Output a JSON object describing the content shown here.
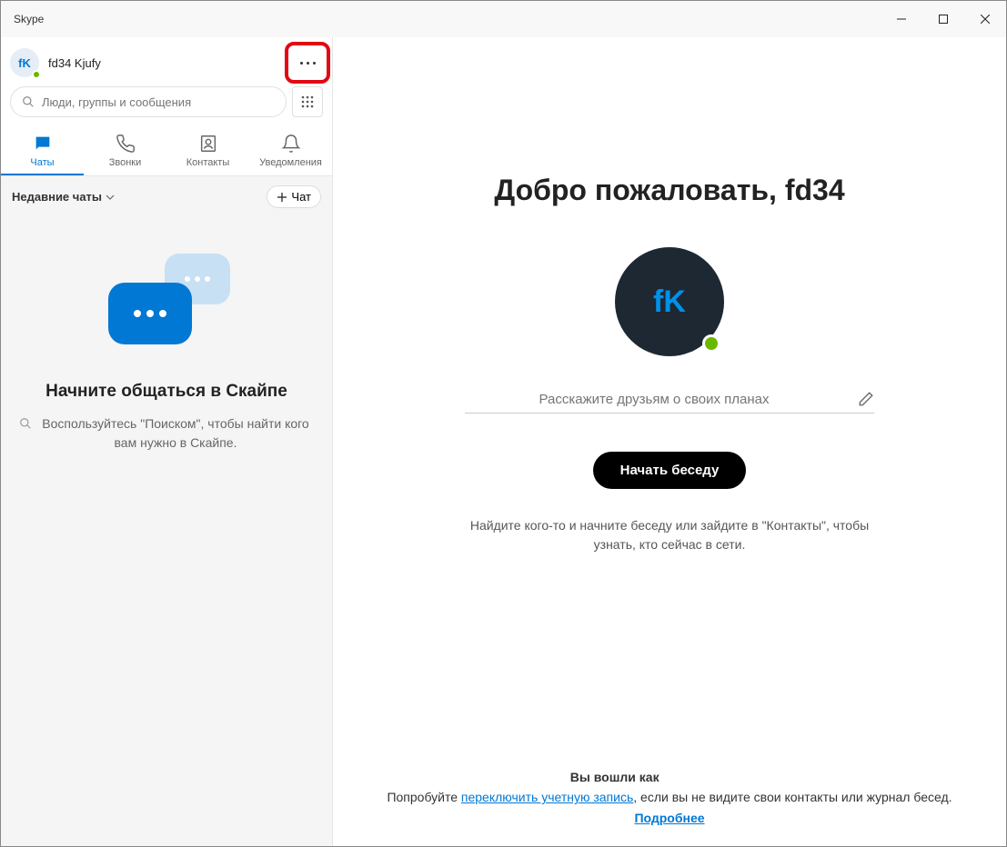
{
  "window": {
    "title": "Skype"
  },
  "profile": {
    "initials": "fK",
    "name": "fd34 Kjufy"
  },
  "search": {
    "placeholder": "Люди, группы и сообщения"
  },
  "tabs": {
    "chats": "Чаты",
    "calls": "Звонки",
    "contacts": "Контакты",
    "notifications": "Уведомления"
  },
  "subheader": {
    "recent": "Недавние чаты",
    "new_chat": "Чат"
  },
  "empty": {
    "title": "Начните общаться в Скайпе",
    "text": "Воспользуйтесь \"Поиском\", чтобы найти кого вам нужно в Скайпе."
  },
  "main": {
    "welcome": "Добро пожаловать, fd34",
    "avatar_initials": "fK",
    "status_placeholder": "Расскажите друзьям о своих планах",
    "start_button": "Начать беседу",
    "find_text": "Найдите кого-то и начните беседу или зайдите в \"Контакты\", чтобы узнать, кто сейчас в сети."
  },
  "footer": {
    "signed_in_as_prefix": "Вы вошли как",
    "try_prefix": "Попробуйте ",
    "switch_account": "переключить учетную запись",
    "try_suffix": ", если вы не видите свои контакты или журнал бесед.",
    "more": "Подробнее"
  }
}
